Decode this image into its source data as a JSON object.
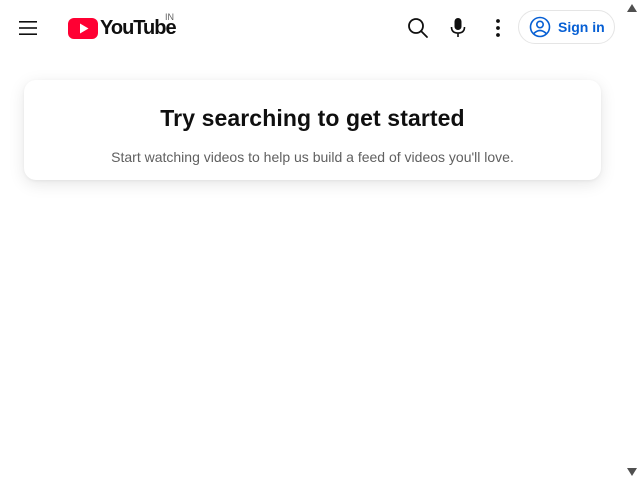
{
  "header": {
    "menu_icon": "hamburger-menu-icon",
    "logo_text": "YouTube",
    "country_code": "IN",
    "search_icon": "search-icon",
    "mic_icon": "microphone-icon",
    "more_icon": "more-vertical-icon",
    "signin_label": "Sign in",
    "signin_icon": "account-circle-icon"
  },
  "empty_state": {
    "title": "Try searching to get started",
    "subtitle": "Start watching videos to help us build a feed of videos you'll love."
  },
  "colors": {
    "brand_red": "#ff0033",
    "link_blue": "#065fd4",
    "text_primary": "#0f0f0f",
    "text_secondary": "#606060"
  }
}
